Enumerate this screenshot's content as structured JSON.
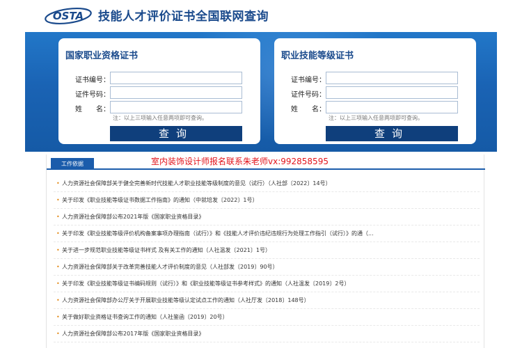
{
  "header": {
    "logo_text": "OSTA",
    "title": "技能人才评价证书全国联网查询"
  },
  "cards": [
    {
      "title": "国家职业资格证书",
      "fields": [
        {
          "label": "证书编号：",
          "value": ""
        },
        {
          "label": "证件号码：",
          "value": ""
        },
        {
          "label": "姓　　名：",
          "value": ""
        }
      ],
      "hint": "注：以上三项输入任意两项即可查询。",
      "button": "查询"
    },
    {
      "title": "职业技能等级证书",
      "fields": [
        {
          "label": "证书编号：",
          "value": ""
        },
        {
          "label": "证件号码：",
          "value": ""
        },
        {
          "label": "姓　　名：",
          "value": ""
        }
      ],
      "hint": "注：以上三项输入任意两项即可查询。",
      "button": "查询"
    }
  ],
  "content": {
    "tab": "工作依据",
    "promo": "室内装饰设计师报名联系朱老师vx:992858595",
    "bullet": "•",
    "news": [
      "人力资源社会保障部关于健全完善新时代技能人才职业技能等级制度的意见（试行）（人社部〔2022〕14号）",
      "关于印发《职业技能等级证书数据工作指南》的通知（中就培发〔2022〕1号）",
      "人力资源社会保障部公布2021年版《国家职业资格目录》",
      "关于印发《职业技能等级评价机构备案事项办理指南（试行）》和《技能人才评价违纪违规行为处理工作指引（试行）》的通（...",
      "关于进一步规范职业技能等级证书样式 及有关工作的通知（人社温发〔2021〕1号）",
      "人力资源社会保障部关于改革完善技能人才评价制度的意见（人社部发〔2019〕90号）",
      "关于印发《职业技能等级证书编码规则（试行）》和《职业技能等级证书参考样式》的通知（人社温发〔2019〕2号）",
      "人力资源社会保障部办公厅关于开展职业技能等级认定试点工作的通知（人社厅发〔2018〕148号）",
      "关于做好职业资格证书查询工作的通知（人社鉴函〔2019〕20号）",
      "人力资源社会保障部公布2017年版《国家职业资格目录》"
    ]
  }
}
